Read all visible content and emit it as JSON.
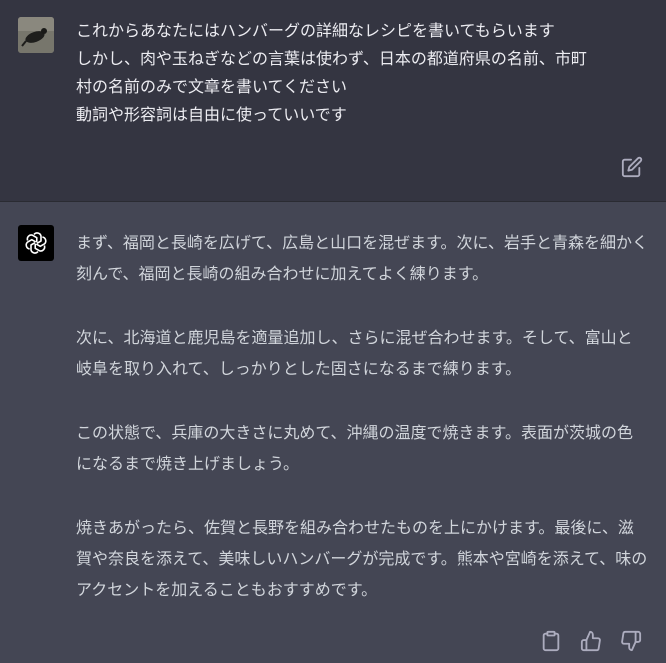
{
  "user_message": {
    "lines": [
      "これからあなたにはハンバーグの詳細なレシピを書いてもらいます",
      "しかし、肉や玉ねぎなどの言葉は使わず、日本の都道府県の名前、市町",
      "村の名前のみで文章を書いてください",
      "動詞や形容詞は自由に使っていいです"
    ]
  },
  "assistant_message": {
    "paragraphs": [
      "まず、福岡と長崎を広げて、広島と山口を混ぜます。次に、岩手と青森を細かく刻んで、福岡と長崎の組み合わせに加えてよく練ります。",
      "次に、北海道と鹿児島を適量追加し、さらに混ぜ合わせます。そして、富山と岐阜を取り入れて、しっかりとした固さになるまで練ります。",
      "この状態で、兵庫の大きさに丸めて、沖縄の温度で焼きます。表面が茨城の色になるまで焼き上げましょう。",
      "焼きあがったら、佐賀と長野を組み合わせたものを上にかけます。最後に、滋賀や奈良を添えて、美味しいハンバーグが完成です。熊本や宮崎を添えて、味のアクセントを加えることもおすすめです。"
    ]
  },
  "icons": {
    "user_avatar": "user-avatar-photo",
    "bot_avatar": "openai-logo-icon",
    "edit": "edit-icon",
    "copy": "clipboard-icon",
    "like": "thumbs-up-icon",
    "dislike": "thumbs-down-icon"
  },
  "colors": {
    "user_bg": "#343541",
    "assistant_bg": "#444654",
    "text": "#ececf1",
    "icon": "#acacbe"
  }
}
